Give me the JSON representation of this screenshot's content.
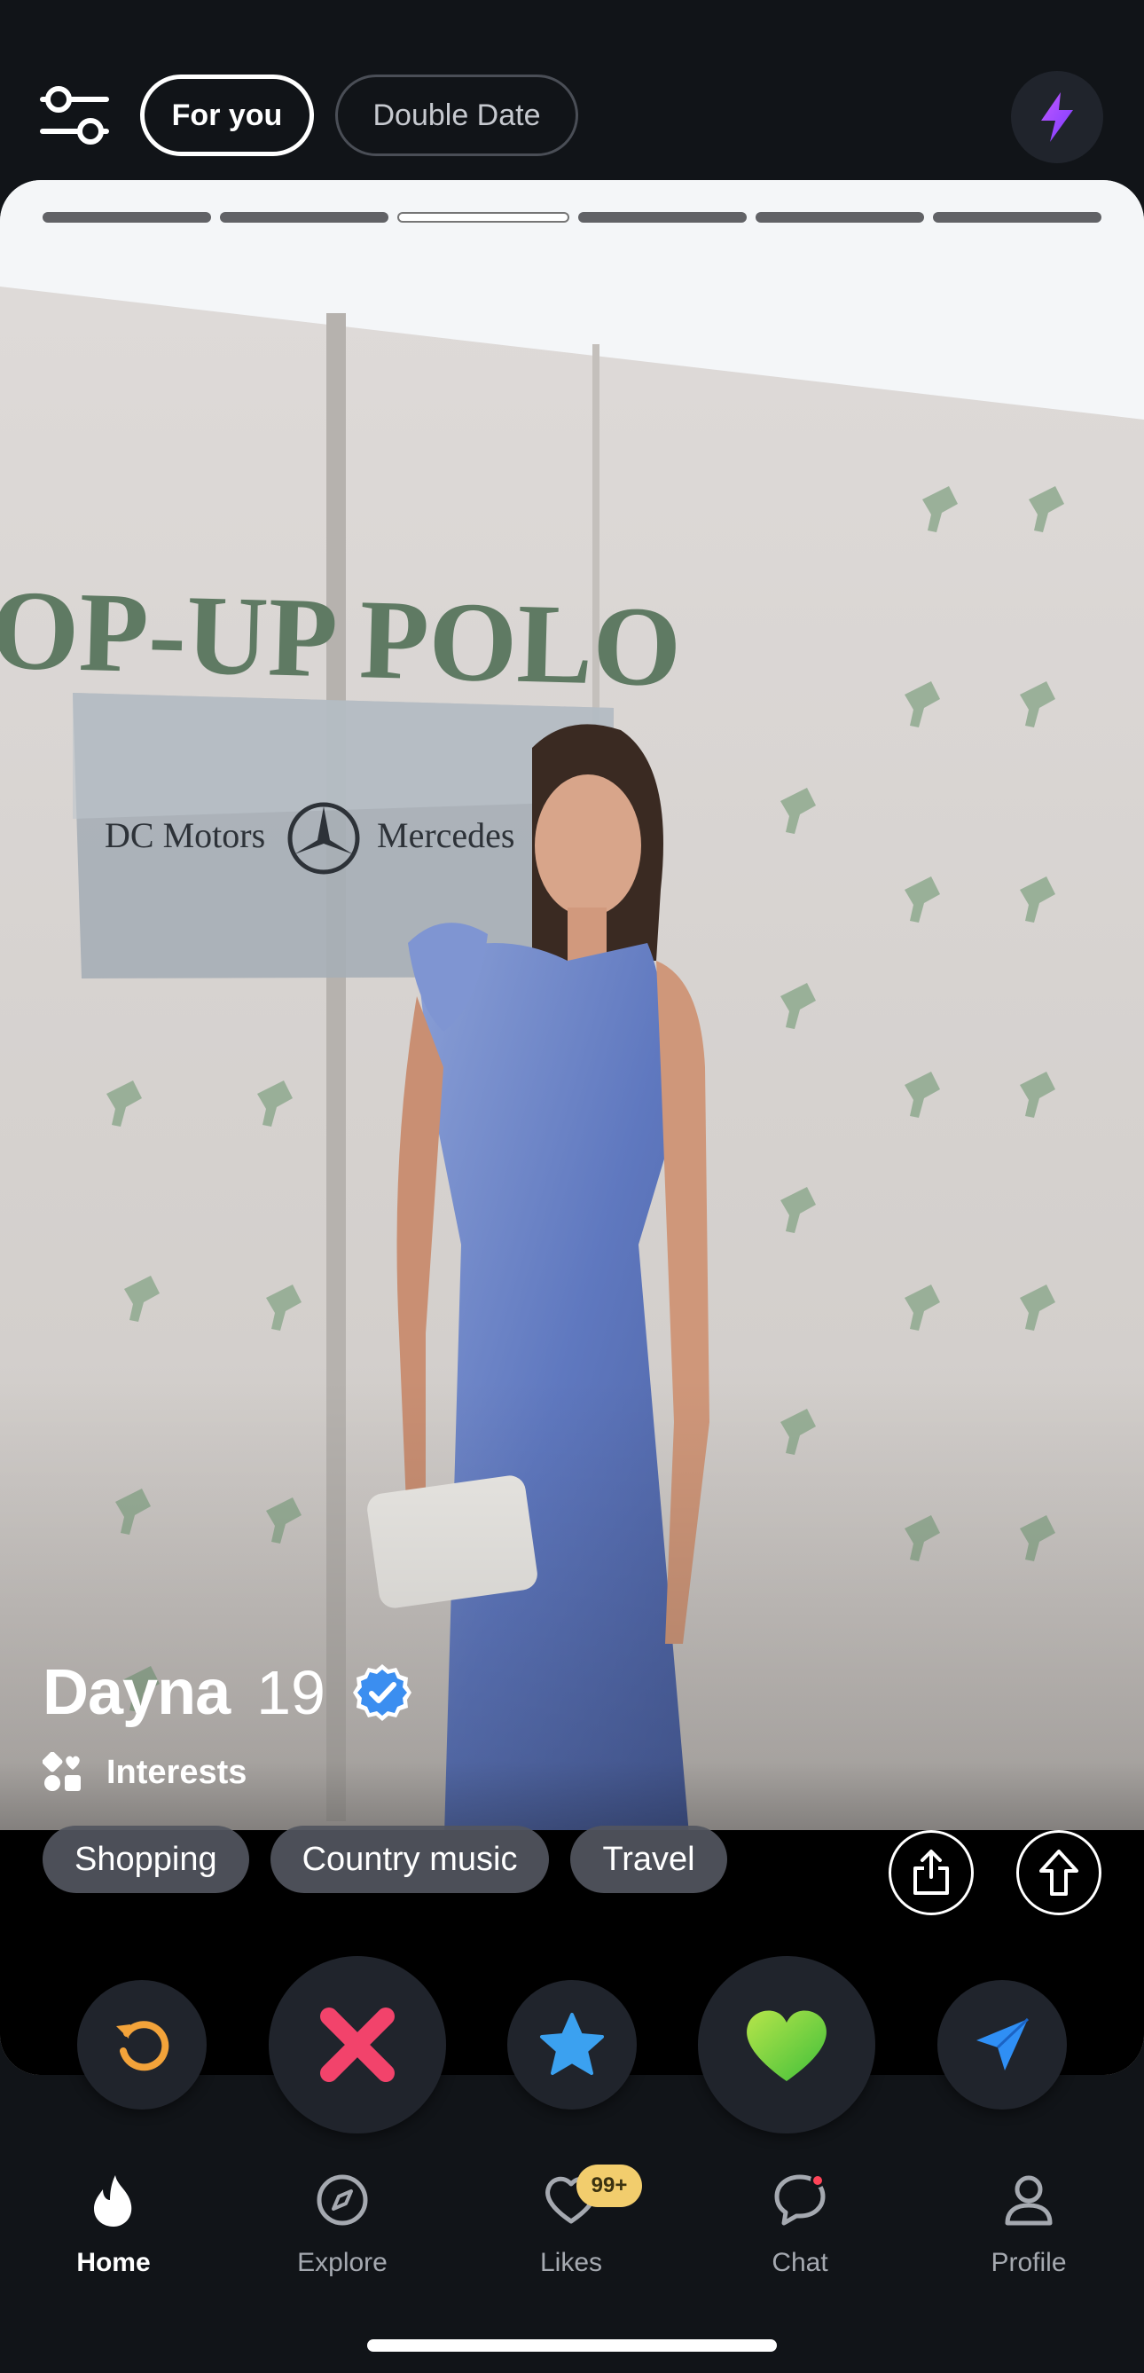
{
  "top_bar": {
    "filter_icon": "sliders-icon",
    "tabs": [
      {
        "label": "For you",
        "active": true
      },
      {
        "label": "Double Date",
        "active": false
      }
    ],
    "boost_icon": "lightning-bolt-icon"
  },
  "card": {
    "photo_count": 6,
    "active_photo_index": 3,
    "photo_signage": {
      "banner_text": "OP-UP POLO",
      "sign_left": "DC Motors",
      "sign_right": "Mercedes"
    },
    "name": "Dayna",
    "age": "19",
    "verified_icon": "verified-badge-icon",
    "interests_label": "Interests",
    "interests": [
      "Shopping",
      "Country music",
      "Travel"
    ],
    "share_icon": "share-icon",
    "expand_icon": "arrow-up-icon"
  },
  "actions": [
    {
      "name": "rewind",
      "icon": "rewind-icon",
      "color": "#f3a33a"
    },
    {
      "name": "nope",
      "icon": "x-icon",
      "color": "#f2436b"
    },
    {
      "name": "super-like",
      "icon": "star-icon",
      "color": "#3ba1f0"
    },
    {
      "name": "like",
      "icon": "heart-icon",
      "color": "#7bd42a"
    },
    {
      "name": "boost",
      "icon": "send-icon",
      "color": "#2f8ff5"
    }
  ],
  "nav": {
    "items": [
      {
        "label": "Home",
        "icon": "flame-icon",
        "active": true
      },
      {
        "label": "Explore",
        "icon": "compass-icon",
        "active": false
      },
      {
        "label": "Likes",
        "icon": "heart-outline-icon",
        "active": false,
        "badge": "99+"
      },
      {
        "label": "Chat",
        "icon": "chat-bubble-icon",
        "active": false
      },
      {
        "label": "Profile",
        "icon": "person-icon",
        "active": false
      }
    ]
  }
}
